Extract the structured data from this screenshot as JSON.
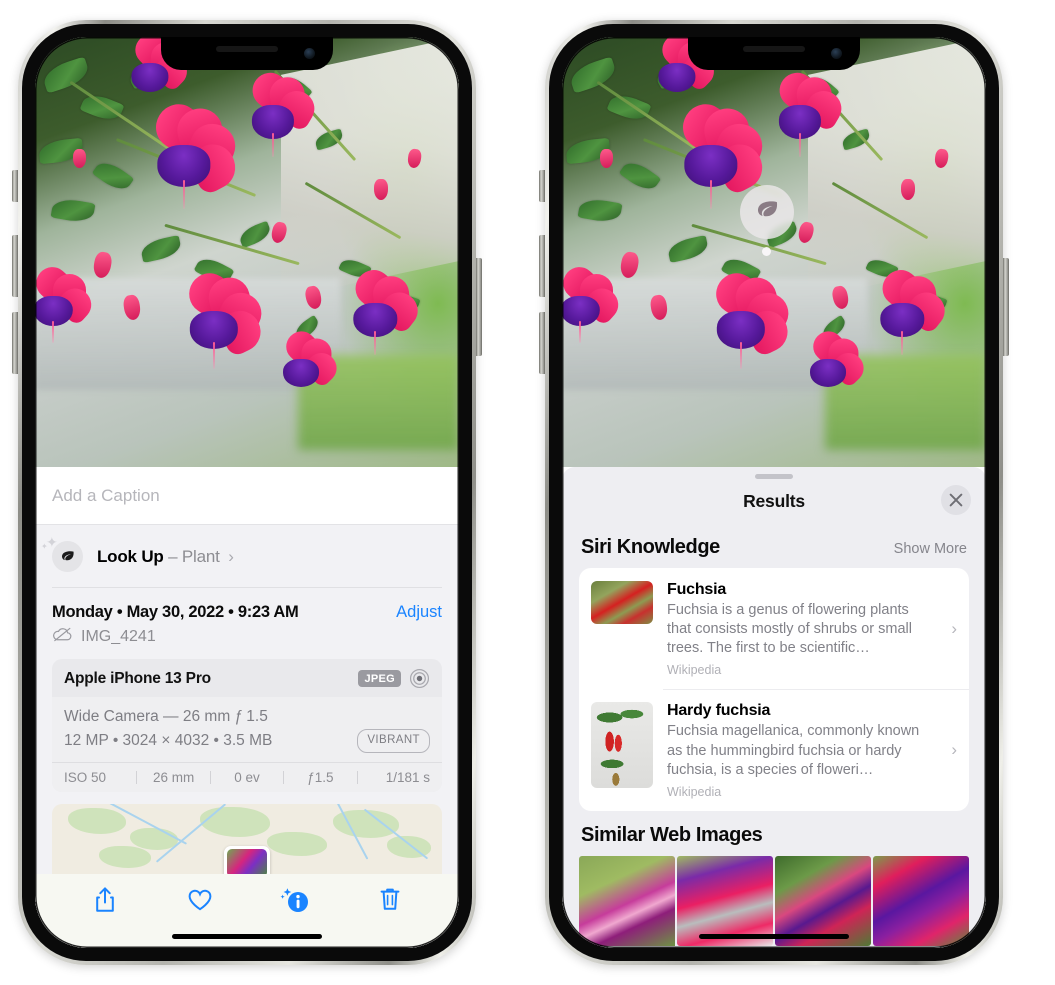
{
  "figure": {
    "description": "Two iPhone screenshots side by side showing Photos app info sheet with Visual Look Up and the Siri Knowledge Results panel"
  },
  "left_phone": {
    "photo_alt": "Hanging basket of pink and purple fuchsia flowers",
    "caption_field": {
      "placeholder": "Add a Caption",
      "value": ""
    },
    "lookup": {
      "icon": "leaf-icon",
      "label": "Look Up",
      "separator": "–",
      "subject": "Plant",
      "chevron": "›"
    },
    "date_row": {
      "date": "Monday • May 30, 2022 • 9:23 AM",
      "adjust_label": "Adjust"
    },
    "file_row": {
      "icon": "icloud-slash-icon",
      "filename": "IMG_4241"
    },
    "exif": {
      "device": "Apple iPhone 13 Pro",
      "format_badge": "JPEG",
      "lens_icon": "lens-icon",
      "lens_line": "Wide Camera — 26 mm ƒ 1.5",
      "specs_line": "12 MP • 3024 × 4032 • 3.5 MB",
      "style_badge": "VIBRANT",
      "stats": [
        "ISO 50",
        "26 mm",
        "0 ev",
        "ƒ1.5",
        "1/181 s"
      ]
    },
    "map": {
      "pin_label": "photo-location-pin"
    },
    "toolbar": [
      {
        "name": "share-button",
        "icon": "share-icon"
      },
      {
        "name": "favorite-button",
        "icon": "heart-icon"
      },
      {
        "name": "info-button",
        "icon": "info-sparkle-icon"
      },
      {
        "name": "delete-button",
        "icon": "trash-icon"
      }
    ],
    "accent_color": "#1a84ff"
  },
  "right_phone": {
    "photo_alt": "Hanging basket of pink and purple fuchsia flowers",
    "visual_lookup_badge": {
      "icon": "leaf-icon",
      "name": "visual-look-up-badge"
    },
    "sheet": {
      "title": "Results",
      "close_icon": "close-icon",
      "sections": [
        {
          "title": "Siri Knowledge",
          "action": "Show More",
          "items": [
            {
              "title": "Fuchsia",
              "description": "Fuchsia is a genus of flowering plants that consists mostly of shrubs or small trees. The first to be scientific…",
              "source": "Wikipedia",
              "thumb": "fuchsia-thumbnail",
              "chevron": "›"
            },
            {
              "title": "Hardy fuchsia",
              "description": "Fuchsia magellanica, commonly known as the hummingbird fuchsia or hardy fuchsia, is a species of floweri…",
              "source": "Wikipedia",
              "thumb": "hardy-fuchsia-thumbnail",
              "chevron": "›"
            }
          ]
        },
        {
          "title": "Similar Web Images",
          "action": "",
          "images": [
            "similar-web-image-1",
            "similar-web-image-2",
            "similar-web-image-3",
            "similar-web-image-4"
          ]
        }
      ]
    }
  }
}
